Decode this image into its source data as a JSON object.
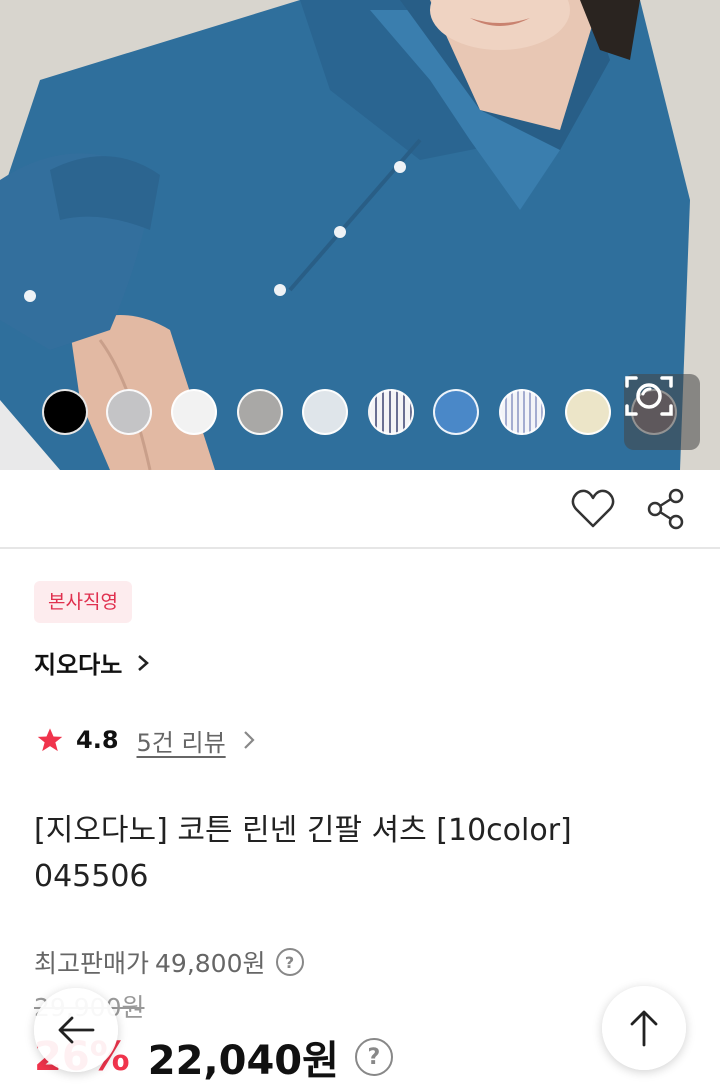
{
  "product": {
    "swatch_colors": [
      "#000000",
      "#c4c4c6",
      "#f2f2f2",
      "#a9a8a6",
      "#dfe5ea",
      "stripe-navy",
      "#4a88c8",
      "stripe-light",
      "#ece5c8",
      "#7c6f78"
    ],
    "badge": "본사직영",
    "brand": "지오다노",
    "rating": "4.8",
    "reviews": "5건 리뷰",
    "title": "[지오다노] 코튼 린넨 긴팔 셔츠 [10color] 045506",
    "max_price_label": "최고판매가",
    "max_price": "49,800원",
    "original_price": "29,900원",
    "discount": "26%",
    "sale_price": "22,040원"
  },
  "icons": {
    "lens": "image-search-icon",
    "wishlist": "heart-icon",
    "share": "share-icon",
    "back": "arrow-left-icon",
    "top": "arrow-up-icon",
    "star": "star-icon",
    "help": "question-icon"
  },
  "colors": {
    "accent": "#f0344c",
    "badge_bg": "#fdecee"
  }
}
